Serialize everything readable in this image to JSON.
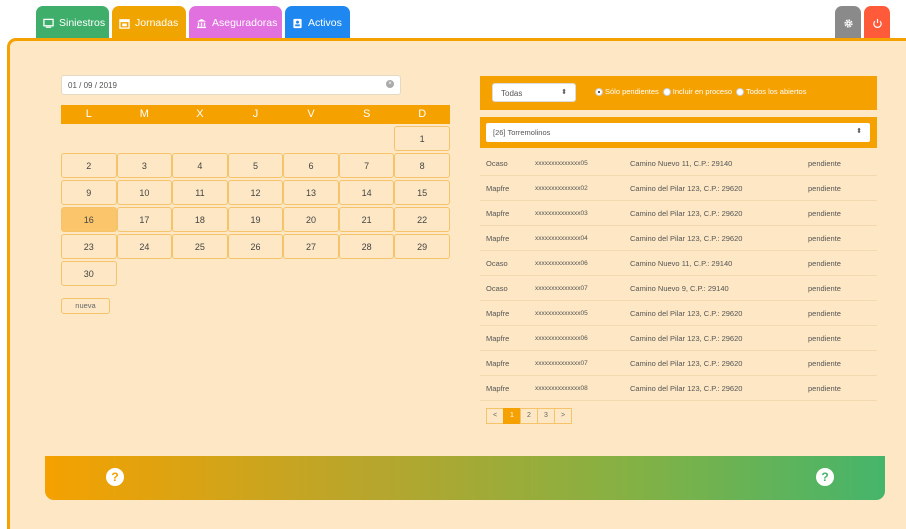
{
  "tabs": [
    {
      "label": "Siniestros",
      "icon": "monitor-icon",
      "color": "#3fae6b"
    },
    {
      "label": "Jornadas",
      "icon": "calendar-icon",
      "color": "#f0a400"
    },
    {
      "label": "Aseguradoras",
      "icon": "bank-icon",
      "color": "#e071df"
    },
    {
      "label": "Activos",
      "icon": "id-card-icon",
      "color": "#1e88f0"
    }
  ],
  "right_tabs": [
    {
      "icon": "gear-icon",
      "color": "#8a8a8a"
    },
    {
      "icon": "power-icon",
      "color": "#ff5a3a"
    }
  ],
  "date_input": {
    "value": "01 / 09 / 2019"
  },
  "calendar": {
    "weekdays": [
      "L",
      "M",
      "X",
      "J",
      "V",
      "S",
      "D"
    ],
    "weeks": [
      [
        "",
        "",
        "",
        "",
        "",
        "",
        "1"
      ],
      [
        "2",
        "3",
        "4",
        "5",
        "6",
        "7",
        "8"
      ],
      [
        "9",
        "10",
        "11",
        "12",
        "13",
        "14",
        "15"
      ],
      [
        "16",
        "17",
        "18",
        "19",
        "20",
        "21",
        "22"
      ],
      [
        "23",
        "24",
        "25",
        "26",
        "27",
        "28",
        "29"
      ],
      [
        "30",
        "",
        "",
        "",
        "",
        "",
        ""
      ]
    ],
    "selected": "16"
  },
  "new_button": {
    "label": "nueva"
  },
  "filters": {
    "status_select": "Todas",
    "radios": [
      {
        "label": "Sólo pendientes",
        "checked": true
      },
      {
        "label": "Incluir en proceso",
        "checked": false
      },
      {
        "label": "Todos los abiertos",
        "checked": false
      }
    ]
  },
  "town_select": "[26] Torremolinos",
  "claims": [
    {
      "insurer": "Ocaso",
      "ref": "xxxxxxxxxxxxxx05",
      "address": "Camino Nuevo 11, C.P.: 29140",
      "status": "pendiente"
    },
    {
      "insurer": "Mapfre",
      "ref": "xxxxxxxxxxxxxx02",
      "address": "Camino del Pilar 123, C.P.: 29620",
      "status": "pendiente"
    },
    {
      "insurer": "Mapfre",
      "ref": "xxxxxxxxxxxxxx03",
      "address": "Camino del Pilar 123, C.P.: 29620",
      "status": "pendiente"
    },
    {
      "insurer": "Mapfre",
      "ref": "xxxxxxxxxxxxxx04",
      "address": "Camino del Pilar 123, C.P.: 29620",
      "status": "pendiente"
    },
    {
      "insurer": "Ocaso",
      "ref": "xxxxxxxxxxxxxx06",
      "address": "Camino Nuevo 11, C.P.: 29140",
      "status": "pendiente"
    },
    {
      "insurer": "Ocaso",
      "ref": "xxxxxxxxxxxxxx07",
      "address": "Camino Nuevo 9, C.P.: 29140",
      "status": "pendiente"
    },
    {
      "insurer": "Mapfre",
      "ref": "xxxxxxxxxxxxxx05",
      "address": "Camino del Pilar 123, C.P.: 29620",
      "status": "pendiente"
    },
    {
      "insurer": "Mapfre",
      "ref": "xxxxxxxxxxxxxx06",
      "address": "Camino del Pilar 123, C.P.: 29620",
      "status": "pendiente"
    },
    {
      "insurer": "Mapfre",
      "ref": "xxxxxxxxxxxxxx07",
      "address": "Camino del Pilar 123, C.P.: 29620",
      "status": "pendiente"
    },
    {
      "insurer": "Mapfre",
      "ref": "xxxxxxxxxxxxxx08",
      "address": "Camino del Pilar 123, C.P.: 29620",
      "status": "pendiente"
    }
  ],
  "pagination": {
    "prev": "<",
    "pages": [
      "1",
      "2",
      "3"
    ],
    "current": "1",
    "next": ">"
  },
  "footer": {
    "help_left": "?",
    "help_right": "?"
  }
}
